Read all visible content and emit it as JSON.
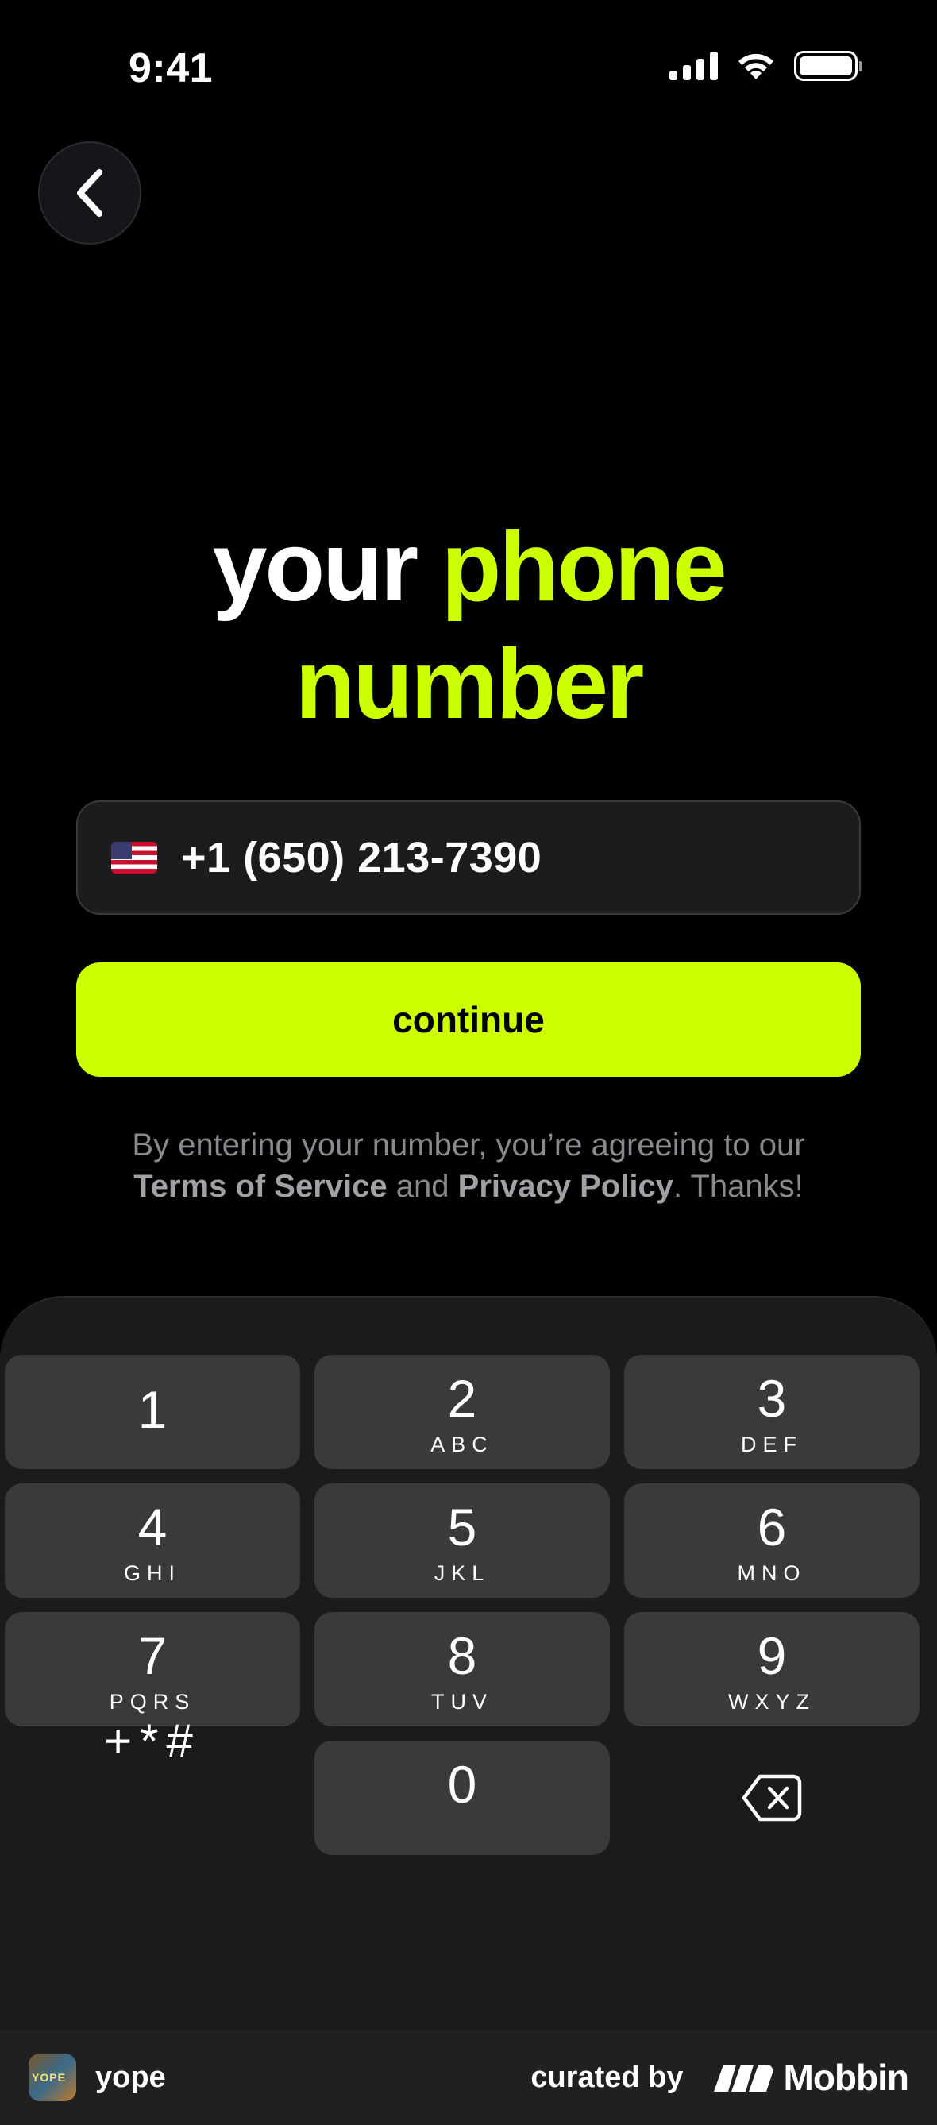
{
  "status": {
    "time": "9:41"
  },
  "heading": {
    "word1": "your",
    "word2": "phone",
    "word3": "number"
  },
  "phone": {
    "value": "+1 (650) 213-7390",
    "country": "US"
  },
  "continue_label": "continue",
  "terms": {
    "prefix": "By entering your number, you’re agreeing to our",
    "tos": "Terms of Service",
    "and": "and",
    "privacy": "Privacy Policy",
    "suffix": ". Thanks!"
  },
  "keypad": {
    "keys": [
      {
        "digit": "1",
        "letters": ""
      },
      {
        "digit": "2",
        "letters": "ABC"
      },
      {
        "digit": "3",
        "letters": "DEF"
      },
      {
        "digit": "4",
        "letters": "GHI"
      },
      {
        "digit": "5",
        "letters": "JKL"
      },
      {
        "digit": "6",
        "letters": "MNO"
      },
      {
        "digit": "7",
        "letters": "PQRS"
      },
      {
        "digit": "8",
        "letters": "TUV"
      },
      {
        "digit": "9",
        "letters": "WXYZ"
      },
      {
        "digit": "0",
        "letters": ""
      }
    ],
    "symbols": "+*#",
    "delete_icon": "delete-backspace-icon"
  },
  "footer": {
    "app_name": "yope",
    "app_icon_text": "YOPE",
    "curated_by": "curated by",
    "brand": "Mobbin"
  },
  "colors": {
    "accent": "#ccff00",
    "background": "#000000",
    "keypad_bg": "#1b1b1d",
    "key_bg": "#3a3a3c"
  }
}
